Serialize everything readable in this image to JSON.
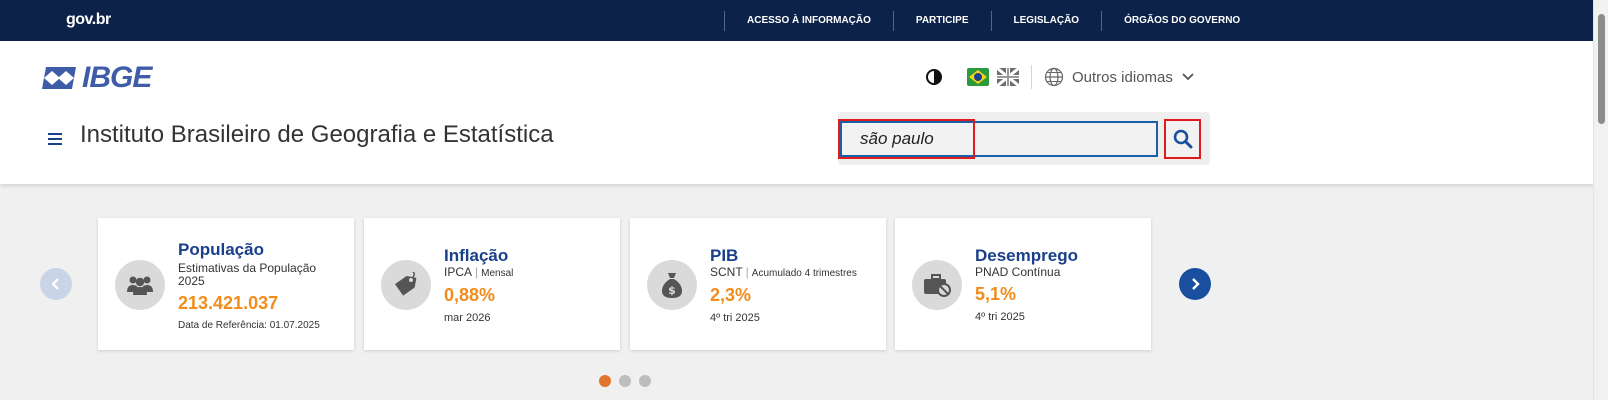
{
  "govbar": {
    "logo": "gov.br",
    "links": [
      "ACESSO À INFORMAÇÃO",
      "PARTICIPE",
      "LEGISLAÇÃO",
      "ÓRGÃOS DO GOVERNO"
    ]
  },
  "header": {
    "logo_text": "IBGE",
    "site_title": "Instituto Brasileiro de Geografia e Estatística",
    "lang_label": "Outros idiomas",
    "icons": [
      "contrast-icon",
      "flag-brazil-icon",
      "flag-uk-icon",
      "globe-icon",
      "chevron-down-icon",
      "menu-icon",
      "search-icon"
    ]
  },
  "search": {
    "value": "são paulo"
  },
  "indicators": [
    {
      "title": "População",
      "subtitle": "Estimativas da População 2025",
      "value": "213.421.037",
      "footer": "Data de Referência: 01.07.2025",
      "icon": "people-icon"
    },
    {
      "title": "Inflação",
      "subtitle": "IPCA",
      "subtitle_detail": "Mensal",
      "value": "0,88%",
      "footer": "mar 2026",
      "icon": "price-tag-icon"
    },
    {
      "title": "PIB",
      "subtitle": "SCNT",
      "subtitle_detail": "Acumulado 4 trimestres",
      "value": "2,3%",
      "footer": "4º tri 2025",
      "icon": "money-bag-icon"
    },
    {
      "title": "Desemprego",
      "subtitle": "PNAD Contínua",
      "value": "5,1%",
      "footer": "4º tri 2025",
      "icon": "briefcase-blocked-icon"
    }
  ],
  "carousel": {
    "pages": 3,
    "active": 1
  },
  "colors": {
    "govbar_bg": "#0c2249",
    "brand_blue": "#1a3f8b",
    "value_orange": "#f28c1b",
    "highlight_red": "#e01b1b"
  }
}
